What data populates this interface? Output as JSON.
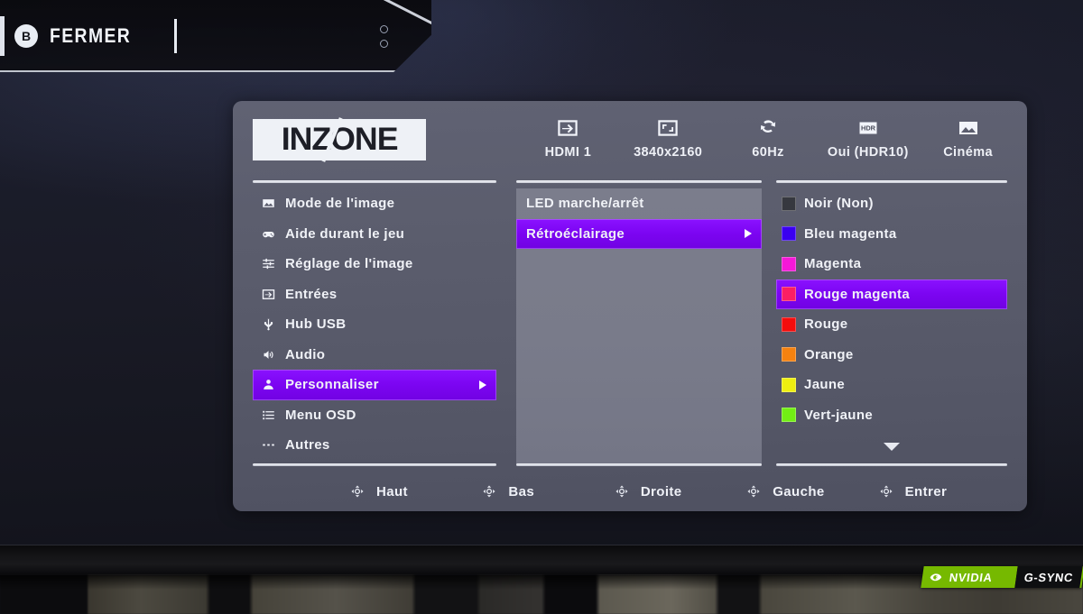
{
  "overlay": {
    "button_glyph": "B",
    "close_label": "FERMER"
  },
  "osd": {
    "brand": "INZONE",
    "status": [
      {
        "icon": "input-arrow-icon",
        "label": "HDMI 1"
      },
      {
        "icon": "resolution-icon",
        "label": "3840x2160"
      },
      {
        "icon": "refresh-rate-icon",
        "label": "60Hz"
      },
      {
        "icon": "hdr-icon",
        "label": "Oui (HDR10)"
      },
      {
        "icon": "picture-mode-icon",
        "label": "Cinéma"
      }
    ],
    "menu": [
      {
        "icon": "picture-icon",
        "label": "Mode de l'image",
        "selected": false,
        "has_submenu": false
      },
      {
        "icon": "gamepad-icon",
        "label": "Aide durant le jeu",
        "selected": false,
        "has_submenu": false
      },
      {
        "icon": "sliders-icon",
        "label": "Réglage de l'image",
        "selected": false,
        "has_submenu": false
      },
      {
        "icon": "input-icon",
        "label": "Entrées",
        "selected": false,
        "has_submenu": false
      },
      {
        "icon": "usb-icon",
        "label": "Hub USB",
        "selected": false,
        "has_submenu": false
      },
      {
        "icon": "speaker-icon",
        "label": "Audio",
        "selected": false,
        "has_submenu": false
      },
      {
        "icon": "person-icon",
        "label": "Personnaliser",
        "selected": true,
        "has_submenu": true
      },
      {
        "icon": "list-icon",
        "label": "Menu OSD",
        "selected": false,
        "has_submenu": false
      },
      {
        "icon": "ellipsis-icon",
        "label": "Autres",
        "selected": false,
        "has_submenu": false
      }
    ],
    "submenu": [
      {
        "label": "LED marche/arrêt",
        "selected": false,
        "has_submenu": false
      },
      {
        "label": "Rétroéclairage",
        "selected": true,
        "has_submenu": true
      }
    ],
    "colors": [
      {
        "label": "Noir (Non)",
        "swatch": "#36383f",
        "selected": false
      },
      {
        "label": "Bleu magenta",
        "swatch": "#3a00f0",
        "selected": false
      },
      {
        "label": "Magenta",
        "swatch": "#f518d8",
        "selected": false
      },
      {
        "label": "Rouge magenta",
        "swatch": "#fb1f64",
        "selected": true
      },
      {
        "label": "Rouge",
        "swatch": "#f40d0d",
        "selected": false
      },
      {
        "label": "Orange",
        "swatch": "#f58210",
        "selected": false
      },
      {
        "label": "Jaune",
        "swatch": "#eeef10",
        "selected": false
      },
      {
        "label": "Vert-jaune",
        "swatch": "#72ef14",
        "selected": false
      }
    ],
    "has_more_colors": true,
    "nav": [
      {
        "icon": "joystick-icon",
        "label": "Haut"
      },
      {
        "icon": "joystick-icon",
        "label": "Bas"
      },
      {
        "icon": "joystick-icon",
        "label": "Droite"
      },
      {
        "icon": "joystick-icon",
        "label": "Gauche"
      },
      {
        "icon": "joystick-icon",
        "label": "Entrer"
      }
    ]
  },
  "sticker": {
    "brand": "NVIDIA",
    "tech": "G-SYNC",
    "brand_color": "#76b900"
  },
  "theme": {
    "highlight": "#7c05f2",
    "panel_bg": "#5b5d6d",
    "submenu_bg": "#797b8a",
    "text": "#f0f2f7"
  }
}
